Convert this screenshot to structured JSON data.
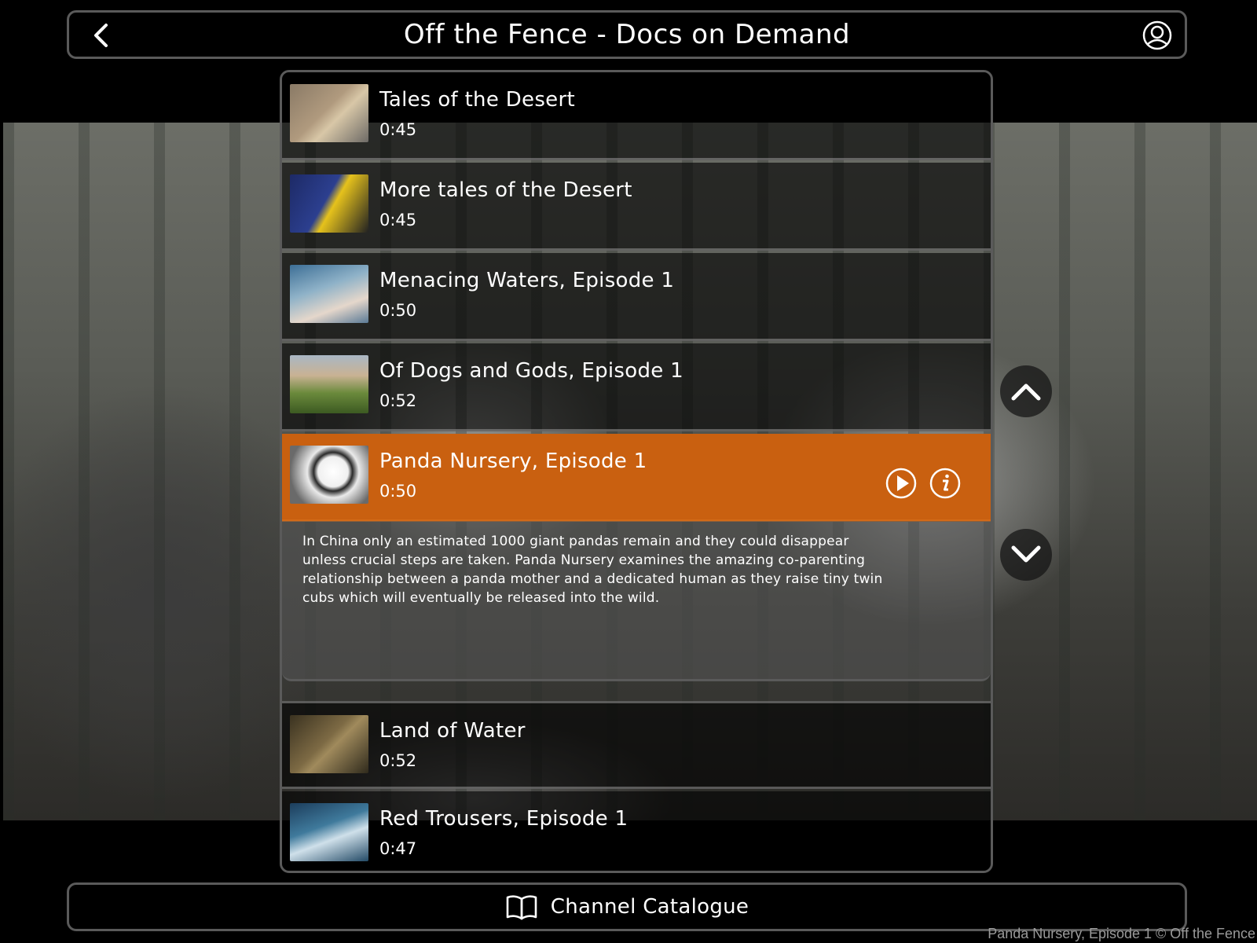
{
  "app": {
    "title": "Off the Fence - Docs on Demand"
  },
  "header": {
    "back_icon": "chevron-left-icon",
    "user_icon": "user-circle-icon"
  },
  "list": {
    "items": [
      {
        "title": "Tales of the Desert",
        "duration": "0:45",
        "selected": false
      },
      {
        "title": "More tales of the Desert",
        "duration": "0:45",
        "selected": false
      },
      {
        "title": "Menacing Waters, Episode 1",
        "duration": "0:50",
        "selected": false
      },
      {
        "title": "Of Dogs and Gods, Episode 1",
        "duration": "0:52",
        "selected": false
      },
      {
        "title": "Panda Nursery, Episode 1",
        "duration": "0:50",
        "selected": true
      },
      {
        "title": "Land of Water",
        "duration": "0:52",
        "selected": false
      },
      {
        "title": "Red Trousers, Episode 1",
        "duration": "0:47",
        "selected": false
      }
    ],
    "selected_description": "In China only an estimated 1000 giant pandas remain and they could disappear unless crucial steps are taken. Panda Nursery examines the amazing co-parenting relationship between a panda mother and a dedicated human as they raise tiny twin cubs which will eventually be released into the wild."
  },
  "actions": {
    "play_icon": "play-icon",
    "info_icon": "info-icon"
  },
  "scroll": {
    "up_icon": "chevron-up-icon",
    "down_icon": "chevron-down-icon"
  },
  "footer": {
    "label": "Channel Catalogue",
    "icon": "book-icon"
  },
  "credit": "Panda Nursery, Episode 1 © Off the Fence",
  "colors": {
    "accent": "#c96010",
    "frame": "#5a5a5a",
    "background": "#000000"
  }
}
